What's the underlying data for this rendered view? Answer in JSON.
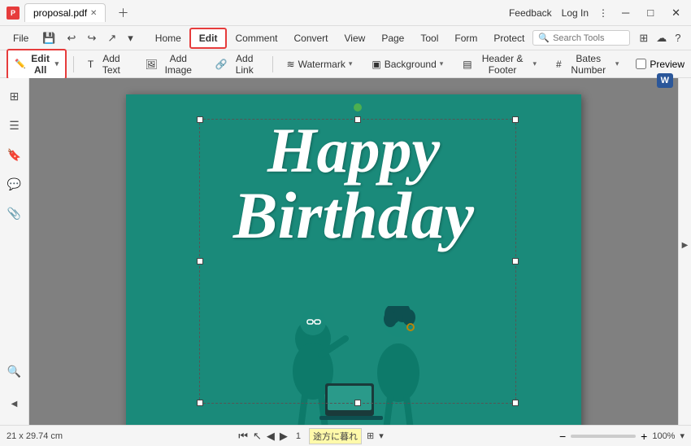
{
  "titleBar": {
    "tabName": "proposal.pdf",
    "feedbackLabel": "Feedback",
    "loginLabel": "Log In"
  },
  "menuBar": {
    "file": "File",
    "items": [
      {
        "label": "Home",
        "active": false
      },
      {
        "label": "Edit",
        "active": true
      },
      {
        "label": "Comment",
        "active": false
      },
      {
        "label": "Convert",
        "active": false
      },
      {
        "label": "View",
        "active": false
      },
      {
        "label": "Page",
        "active": false
      },
      {
        "label": "Tool",
        "active": false
      },
      {
        "label": "Form",
        "active": false
      },
      {
        "label": "Protect",
        "active": false
      }
    ],
    "searchPlaceholder": "Search Tools"
  },
  "toolbar": {
    "editAll": "Edit All",
    "addText": "Add Text",
    "addImage": "Add Image",
    "addLink": "Add Link",
    "watermark": "Watermark",
    "background": "Background",
    "headerFooter": "Header & Footer",
    "batesNumber": "Bates Number",
    "preview": "Preview"
  },
  "leftSidebar": {
    "icons": [
      "⊞",
      "☰",
      "🔖",
      "💬",
      "✉",
      "🔍"
    ]
  },
  "pdfContent": {
    "happyText": "Happy",
    "birthdayText": "Birthday"
  },
  "statusBar": {
    "dimensions": "21 x 29.74 cm",
    "pageInfo": "1",
    "japaneseText": "途方に暮れ",
    "zoomLevel": "100%"
  },
  "winControls": {
    "minimize": "─",
    "maximize": "□",
    "close": "✕"
  }
}
